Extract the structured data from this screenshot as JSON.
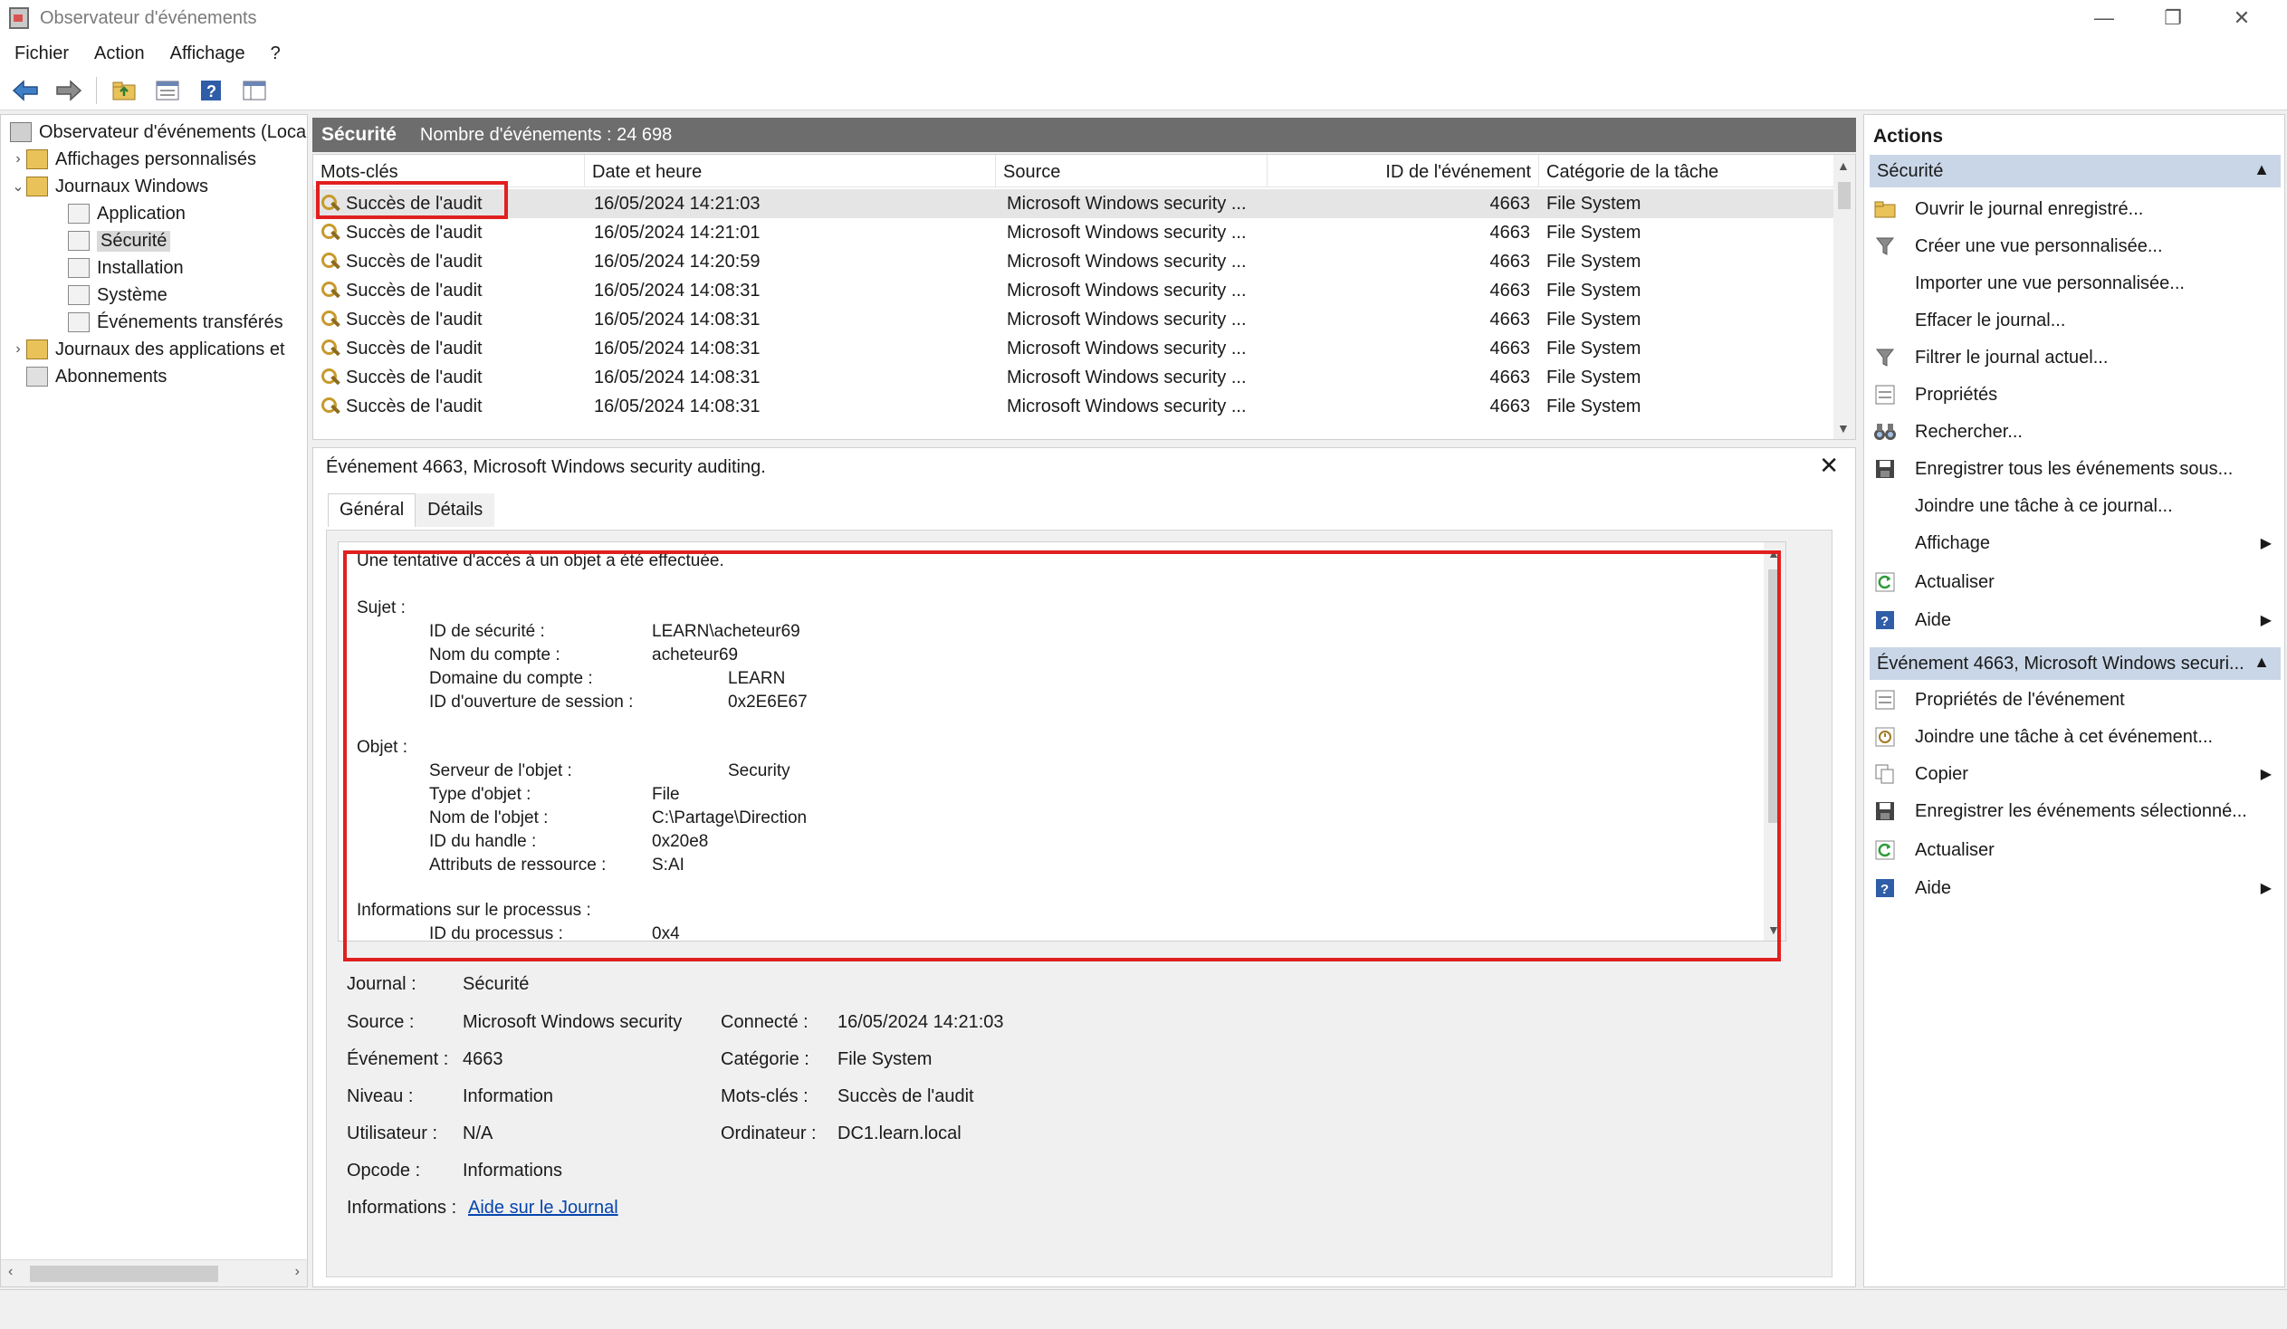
{
  "window": {
    "title": "Observateur d'événements",
    "controls": {
      "minimize": "—",
      "restore": "❐",
      "close": "✕"
    }
  },
  "menubar": {
    "items": [
      "Fichier",
      "Action",
      "Affichage",
      "?"
    ]
  },
  "toolbar": {
    "icons": [
      "back-arrow-icon",
      "forward-arrow-icon",
      "folder-up-icon",
      "properties-icon",
      "help-icon",
      "show-hide-pane-icon"
    ]
  },
  "tree": {
    "root": "Observateur d'événements (Loca",
    "custom_views": "Affichages personnalisés",
    "windows_logs": "Journaux Windows",
    "application": "Application",
    "security": "Sécurité",
    "setup": "Installation",
    "system": "Système",
    "forwarded": "Événements transférés",
    "app_logs": "Journaux des applications et",
    "subscriptions": "Abonnements"
  },
  "list": {
    "title": "Sécurité",
    "count": "Nombre d'événements : 24 698",
    "columns": [
      "Mots-clés",
      "Date et heure",
      "Source",
      "ID de l'événement",
      "Catégorie de la tâche"
    ],
    "rows": [
      {
        "keyword": "Succès de l'audit",
        "date": "16/05/2024 14:21:03",
        "source": "Microsoft Windows security ...",
        "id": "4663",
        "category": "File System"
      },
      {
        "keyword": "Succès de l'audit",
        "date": "16/05/2024 14:21:01",
        "source": "Microsoft Windows security ...",
        "id": "4663",
        "category": "File System"
      },
      {
        "keyword": "Succès de l'audit",
        "date": "16/05/2024 14:20:59",
        "source": "Microsoft Windows security ...",
        "id": "4663",
        "category": "File System"
      },
      {
        "keyword": "Succès de l'audit",
        "date": "16/05/2024 14:08:31",
        "source": "Microsoft Windows security ...",
        "id": "4663",
        "category": "File System"
      },
      {
        "keyword": "Succès de l'audit",
        "date": "16/05/2024 14:08:31",
        "source": "Microsoft Windows security ...",
        "id": "4663",
        "category": "File System"
      },
      {
        "keyword": "Succès de l'audit",
        "date": "16/05/2024 14:08:31",
        "source": "Microsoft Windows security ...",
        "id": "4663",
        "category": "File System"
      },
      {
        "keyword": "Succès de l'audit",
        "date": "16/05/2024 14:08:31",
        "source": "Microsoft Windows security ...",
        "id": "4663",
        "category": "File System"
      },
      {
        "keyword": "Succès de l'audit",
        "date": "16/05/2024 14:08:31",
        "source": "Microsoft Windows security ...",
        "id": "4663",
        "category": "File System"
      }
    ]
  },
  "detail": {
    "title": "Événement 4663, Microsoft Windows security auditing.",
    "close": "✕",
    "tabs": [
      "Général",
      "Détails"
    ],
    "description": {
      "intro": "Une tentative d'accès à un objet a été effectuée.",
      "subject_header": "Sujet :",
      "sid_label": "ID de sécurité :",
      "sid_value": "LEARN\\acheteur69",
      "account_label": "Nom du compte :",
      "account_value": "acheteur69",
      "domain_label": "Domaine du compte :",
      "domain_value": "LEARN",
      "logon_label": "ID d'ouverture de session :",
      "logon_value": "0x2E6E67",
      "object_header": "Objet :",
      "server_label": "Serveur de l'objet :",
      "server_value": "Security",
      "type_label": "Type d'objet :",
      "type_value": "File",
      "name_label": "Nom de l'objet :",
      "name_value": "C:\\Partage\\Direction",
      "handle_label": "ID du handle :",
      "handle_value": "0x20e8",
      "attr_label": "Attributs de ressource :",
      "attr_value": "S:AI",
      "process_header": "Informations sur le processus :",
      "pid_label": "ID du processus :",
      "pid_value": "0x4"
    },
    "props": {
      "journal_label": "Journal :",
      "journal_value": "Sécurité",
      "source_label": "Source :",
      "source_value": "Microsoft Windows security",
      "logged_label": "Connecté :",
      "logged_value": "16/05/2024 14:21:03",
      "event_label": "Événement :",
      "event_value": "4663",
      "category_label": "Catégorie :",
      "category_value": "File System",
      "level_label": "Niveau :",
      "level_value": "Information",
      "keywords_label": "Mots-clés :",
      "keywords_value": "Succès de l'audit",
      "user_label": "Utilisateur :",
      "user_value": "N/A",
      "computer_label": "Ordinateur :",
      "computer_value": "DC1.learn.local",
      "opcode_label": "Opcode :",
      "opcode_value": "Informations",
      "info_label": "Informations :",
      "info_link": "Aide sur le Journal"
    }
  },
  "actions": {
    "title": "Actions",
    "section1": "Sécurité",
    "section1_items": [
      "Ouvrir le journal enregistré...",
      "Créer une vue personnalisée...",
      "Importer une vue personnalisée...",
      "Effacer le journal...",
      "Filtrer le journal actuel...",
      "Propriétés",
      "Rechercher...",
      "Enregistrer tous les événements sous...",
      "Joindre une tâche à ce journal...",
      "Affichage",
      "Actualiser",
      "Aide"
    ],
    "section2": "Événement 4663, Microsoft Windows securi...",
    "section2_items": [
      "Propriétés de l'événement",
      "Joindre une tâche à cet événement...",
      "Copier",
      "Enregistrer les événements sélectionné...",
      "Actualiser",
      "Aide"
    ],
    "colors": {
      "section_bg": "#c9d6e7",
      "highlight_box": "#e0201f"
    }
  }
}
